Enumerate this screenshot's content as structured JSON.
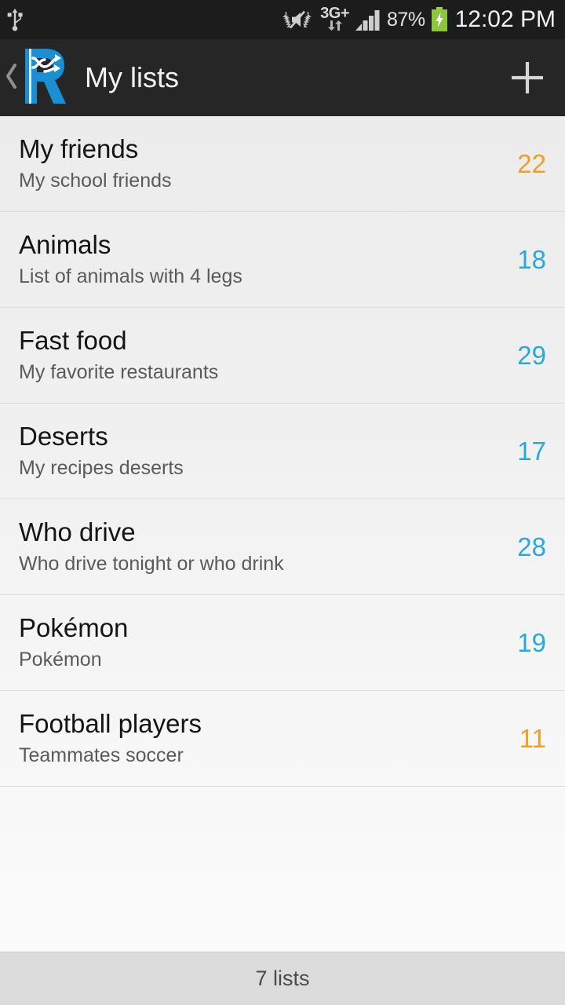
{
  "status_bar": {
    "usb_icon": "usb-icon",
    "mute_icon": "vibrate-mute-icon",
    "network_type": "3G+",
    "data_arrows_icon": "data-transfer-arrows-icon",
    "signal_icon": "signal-bars-icon",
    "battery_percent": "87%",
    "battery_icon": "battery-charging-icon",
    "time": "12:02 PM",
    "colors": {
      "background": "#1c1c1c",
      "battery_green": "#8cc63f"
    }
  },
  "action_bar": {
    "up_icon": "back-chevron-icon",
    "logo_icon": "app-logo-r-shuffle-icon",
    "title": "My lists",
    "add_icon": "plus-icon",
    "colors": {
      "background": "#262626",
      "logo_blue": "#1b8fd4"
    }
  },
  "lists": {
    "items": [
      {
        "title": "My friends",
        "subtitle": "My school friends",
        "count": "22",
        "count_color": "orange"
      },
      {
        "title": "Animals",
        "subtitle": "List of animals with 4 legs",
        "count": "18",
        "count_color": "blue"
      },
      {
        "title": "Fast food",
        "subtitle": "My favorite restaurants",
        "count": "29",
        "count_color": "blue"
      },
      {
        "title": "Deserts",
        "subtitle": "My recipes deserts",
        "count": "17",
        "count_color": "blue"
      },
      {
        "title": "Who drive",
        "subtitle": "Who drive tonight or who drink",
        "count": "28",
        "count_color": "blue"
      },
      {
        "title": "Pokémon",
        "subtitle": "Pokémon",
        "count": "19",
        "count_color": "blue"
      },
      {
        "title": "Football players",
        "subtitle": "Teammates soccer",
        "count": "11",
        "count_color": "orange"
      }
    ],
    "colors": {
      "blue": "#29a8de",
      "orange": "#eda023"
    }
  },
  "bottom_bar": {
    "summary": "7 lists",
    "colors": {
      "background": "#dcdcdc"
    }
  }
}
